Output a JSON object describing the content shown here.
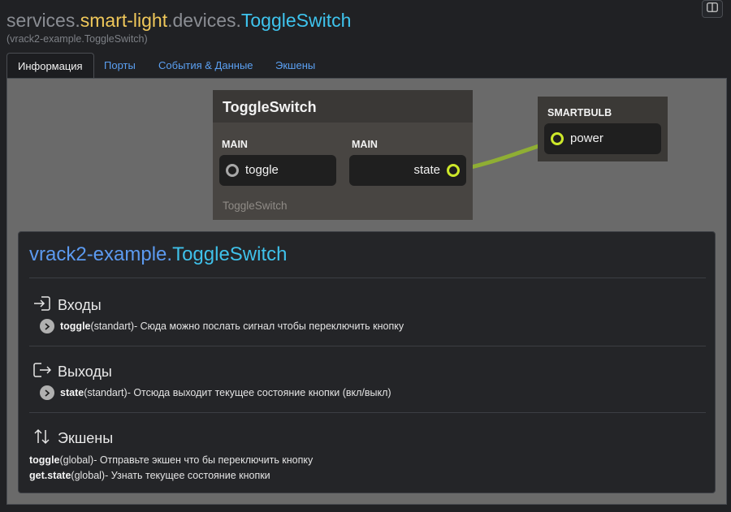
{
  "header": {
    "title_parts": [
      "services",
      ".",
      "smart-light",
      ".",
      "devices",
      ".",
      "ToggleSwitch"
    ],
    "subtitle": "(vrack2-example.ToggleSwitch)"
  },
  "tabs": [
    {
      "label": "Информация",
      "active": true
    },
    {
      "label": "Порты",
      "active": false
    },
    {
      "label": "События & Данные",
      "active": false
    },
    {
      "label": "Экшены",
      "active": false
    }
  ],
  "graph": {
    "toggle_node": {
      "title": "ToggleSwitch",
      "left_column_label": "MAIN",
      "right_column_label": "MAIN",
      "input_port": "toggle",
      "output_port": "state",
      "footer": "ToggleSwitch"
    },
    "bulb_node": {
      "title": "SMARTBULB",
      "input_port": "power"
    },
    "link_color": "#8fae34"
  },
  "info": {
    "title_prefix": "vrack2-example",
    "title_dot": ".",
    "title_name": "ToggleSwitch",
    "inputs": {
      "heading": "Входы",
      "items": [
        {
          "name": "toggle",
          "meta": " (standart)",
          "desc": " - Сюда можно послать сигнал чтобы переключить кнопку"
        }
      ]
    },
    "outputs": {
      "heading": "Выходы",
      "items": [
        {
          "name": "state",
          "meta": " (standart)",
          "desc": " - Отсюда выходит текущее состояние кнопки (вкл/выкл)"
        }
      ]
    },
    "actions": {
      "heading": "Экшены",
      "items": [
        {
          "name": "toggle",
          "meta": " (global)",
          "desc": " - Отправьте экшен что бы переключить кнопку"
        },
        {
          "name": "get.state",
          "meta": " (global)",
          "desc": " - Узнать текущее состояние кнопки"
        }
      ]
    }
  },
  "colors": {
    "background": "#202124",
    "accent_yellow": "#f0c85a",
    "accent_cyan": "#3ec4ee",
    "link_blue": "#5ba0f2",
    "port_green": "#cde82a"
  },
  "icons": [
    "sidebar-toggle-icon",
    "sign-in-icon",
    "sign-out-icon",
    "swap-vertical-icon",
    "play-circle-icon"
  ]
}
